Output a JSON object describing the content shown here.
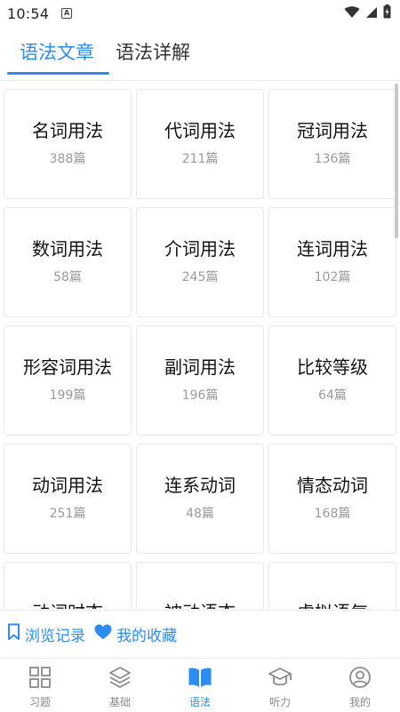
{
  "status_bar": {
    "time": "10:54",
    "notification_badge": "A"
  },
  "tabs": [
    {
      "label": "语法文章",
      "active": true
    },
    {
      "label": "语法详解",
      "active": false
    }
  ],
  "categories": [
    {
      "title": "名词用法",
      "count": "388篇"
    },
    {
      "title": "代词用法",
      "count": "211篇"
    },
    {
      "title": "冠词用法",
      "count": "136篇"
    },
    {
      "title": "数词用法",
      "count": "58篇"
    },
    {
      "title": "介词用法",
      "count": "245篇"
    },
    {
      "title": "连词用法",
      "count": "102篇"
    },
    {
      "title": "形容词用法",
      "count": "199篇"
    },
    {
      "title": "副词用法",
      "count": "196篇"
    },
    {
      "title": "比较等级",
      "count": "64篇"
    },
    {
      "title": "动词用法",
      "count": "251篇"
    },
    {
      "title": "连系动词",
      "count": "48篇"
    },
    {
      "title": "情态动词",
      "count": "168篇"
    },
    {
      "title": "动词时态",
      "count": ""
    },
    {
      "title": "被动语态",
      "count": ""
    },
    {
      "title": "虚拟语气",
      "count": ""
    }
  ],
  "history_bar": {
    "history_label": "浏览记录",
    "favorites_label": "我的收藏"
  },
  "bottom_nav": [
    {
      "label": "习题",
      "icon": "grid-icon",
      "active": false
    },
    {
      "label": "基础",
      "icon": "layers-icon",
      "active": false
    },
    {
      "label": "语法",
      "icon": "book-icon",
      "active": true
    },
    {
      "label": "听力",
      "icon": "graduation-cap-icon",
      "active": false
    },
    {
      "label": "我的",
      "icon": "user-icon",
      "active": false
    }
  ],
  "colors": {
    "accent": "#2d8cf0",
    "inactive": "#8a8a8a",
    "count_text": "#9a9a9a"
  }
}
